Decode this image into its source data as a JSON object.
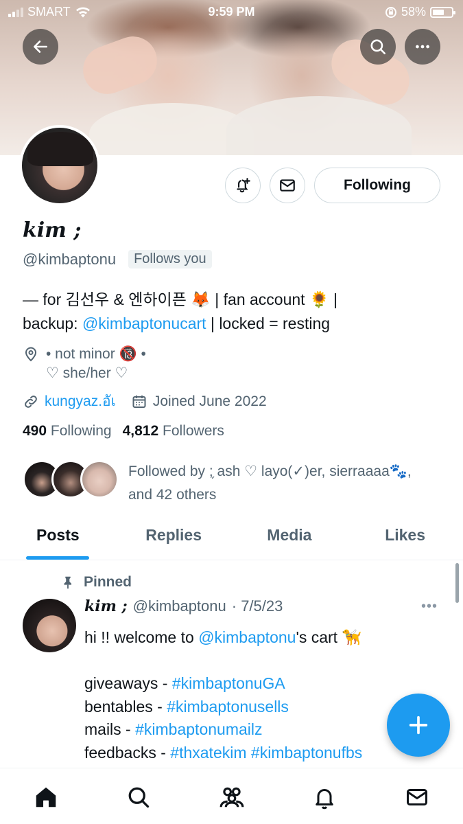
{
  "status_bar": {
    "carrier": "SMART",
    "time": "9:59 PM",
    "battery": "58%"
  },
  "profile": {
    "name": "kim ;",
    "handle": "@kimbaptonu",
    "follows_you": "Follows you",
    "following_button": "Following",
    "bio_line1": "— for 김선우 & 엔하이픈 🦊 | fan account 🌻 |",
    "bio_line2_prefix": "backup: ",
    "bio_link": "@kimbaptonucart",
    "bio_line2_suffix": " | locked = resting",
    "location_line1": "• not minor 🔞 •",
    "location_line2": "♡ she/her ♡",
    "website": "kungyaz.อัเ",
    "joined": "Joined June 2022",
    "following_count": "490",
    "following_label": "Following",
    "followers_count": "4,812",
    "followers_label": "Followers",
    "followed_by_line1": "Followed by ;̗ ash ♡ layo(✓)er, sierraaaa🐾,",
    "followed_by_line2": "and 42 others"
  },
  "tabs": [
    {
      "label": "Posts"
    },
    {
      "label": "Replies"
    },
    {
      "label": "Media"
    },
    {
      "label": "Likes"
    }
  ],
  "post": {
    "pinned_label": "Pinned",
    "author_name": "kim ;",
    "author_handle": "@kimbaptonu",
    "date": "· 7/5/23",
    "more": "•••",
    "line1_prefix": "hi !! welcome to ",
    "line1_mention": "@kimbaptonu",
    "line1_suffix": "'s cart 🦮",
    "line2_prefix": "giveaways - ",
    "line2_tag": "#kimbaptonuGA",
    "line3_prefix": "bentables - ",
    "line3_tag": "#kimbaptonusells",
    "line4_prefix": "mails - ",
    "line4_tag": "#kimbaptonumailz",
    "line5_prefix": "feedbacks - ",
    "line5_tag": "#thxatekim #kimbaptonufbs"
  },
  "icons": {
    "back": "arrow-left-icon",
    "search": "search-icon",
    "more": "more-icon",
    "notify": "bell-plus-icon",
    "message": "mail-icon",
    "location": "location-pin-icon",
    "link": "link-icon",
    "calendar": "calendar-icon",
    "pin": "pin-icon",
    "compose": "plus-icon",
    "nav": [
      "home-icon",
      "search-icon",
      "communities-icon",
      "notifications-icon",
      "messages-icon"
    ]
  },
  "colors": {
    "accent": "#1d9bf0",
    "text": "#0f1419",
    "muted": "#536471"
  }
}
